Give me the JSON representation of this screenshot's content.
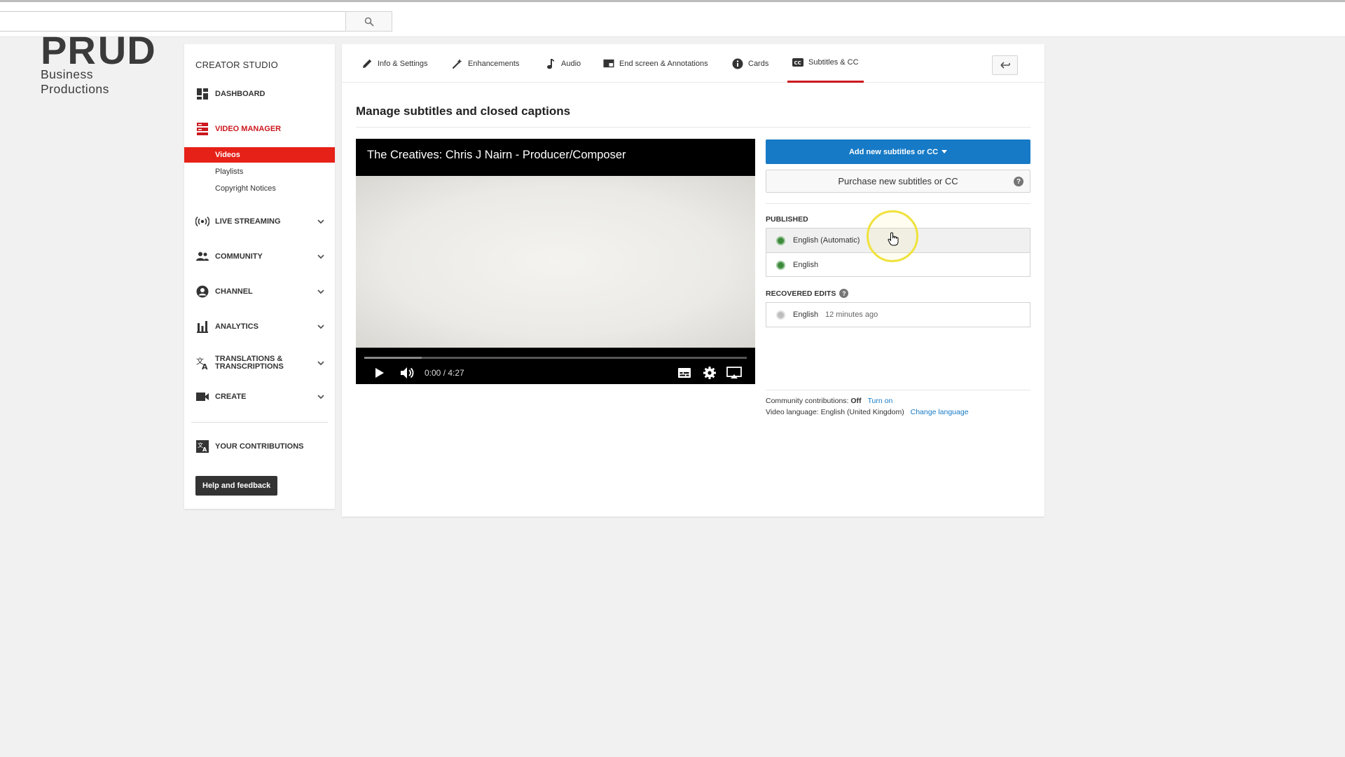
{
  "search": {
    "value": "",
    "placeholder": ""
  },
  "logo": {
    "top_before": "PR",
    "top_after": "UD",
    "subtitle": "Business Productions"
  },
  "sidebar": {
    "title": "CREATOR STUDIO",
    "items": [
      {
        "label": "DASHBOARD"
      },
      {
        "label": "VIDEO MANAGER"
      },
      {
        "label": "LIVE STREAMING"
      },
      {
        "label": "COMMUNITY"
      },
      {
        "label": "CHANNEL"
      },
      {
        "label": "ANALYTICS"
      },
      {
        "label": "TRANSLATIONS & TRANSCRIPTIONS"
      },
      {
        "label": "CREATE"
      },
      {
        "label": "YOUR CONTRIBUTIONS"
      }
    ],
    "subitems": [
      {
        "label": "Videos"
      },
      {
        "label": "Playlists"
      },
      {
        "label": "Copyright Notices"
      }
    ],
    "help_label": "Help and feedback"
  },
  "tabs": [
    {
      "label": "Info & Settings",
      "icon": "pencil-icon"
    },
    {
      "label": "Enhancements",
      "icon": "magic-wand-icon"
    },
    {
      "label": "Audio",
      "icon": "music-note-icon"
    },
    {
      "label": "End screen & Annotations",
      "icon": "end-screen-icon"
    },
    {
      "label": "Cards",
      "icon": "info-icon"
    },
    {
      "label": "Subtitles & CC",
      "icon": "cc-icon"
    }
  ],
  "page": {
    "title": "Manage subtitles and closed captions"
  },
  "video": {
    "title": "The Creatives: Chris J Nairn - Producer/Composer",
    "time": "0:00 / 4:27",
    "loaded_fraction": 0.15
  },
  "actions": {
    "add_label": "Add new subtitles or CC",
    "purchase_label": "Purchase new subtitles or CC"
  },
  "published": {
    "label": "PUBLISHED",
    "tracks": [
      {
        "name": "English (Automatic)"
      },
      {
        "name": "English"
      }
    ]
  },
  "recovered": {
    "label": "RECOVERED EDITS",
    "tracks": [
      {
        "name": "English",
        "meta": "12 minutes ago"
      }
    ]
  },
  "footer": {
    "community_prefix": "Community contributions:",
    "community_value": "Off",
    "community_link": "Turn on",
    "language_prefix": "Video language:",
    "language_value": "English (United Kingdom)",
    "language_link": "Change language"
  },
  "colors": {
    "accent_red": "#cc181e",
    "active_red": "#e62117",
    "button_blue": "#167ac6",
    "published_dot": "#3d8a3d",
    "recovered_dot": "#bdbdbd"
  }
}
